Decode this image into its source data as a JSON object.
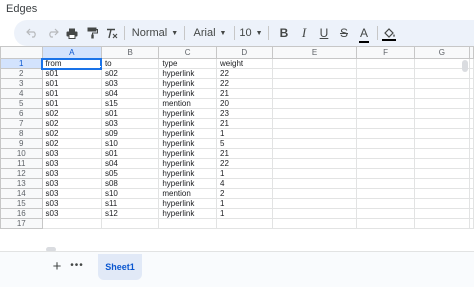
{
  "doc": {
    "title": "Edges"
  },
  "toolbar": {
    "style_label": "Normal",
    "font_label": "Arial",
    "size_label": "10",
    "bold": "B",
    "italic": "I",
    "underline": "U",
    "strikethrough": "S",
    "text_color": "A"
  },
  "grid": {
    "columns": [
      "A",
      "B",
      "C",
      "D",
      "E",
      "F",
      "G"
    ],
    "selected_column": "A",
    "selected_row": 1,
    "rows": [
      {
        "n": "1",
        "cells": [
          "from",
          "to",
          "type",
          "weight"
        ]
      },
      {
        "n": "2",
        "cells": [
          "s01",
          "s02",
          "hyperlink",
          "22"
        ]
      },
      {
        "n": "3",
        "cells": [
          "s01",
          "s03",
          "hyperlink",
          "22"
        ]
      },
      {
        "n": "4",
        "cells": [
          "s01",
          "s04",
          "hyperlink",
          "21"
        ]
      },
      {
        "n": "5",
        "cells": [
          "s01",
          "s15",
          "mention",
          "20"
        ]
      },
      {
        "n": "6",
        "cells": [
          "s02",
          "s01",
          "hyperlink",
          "23"
        ]
      },
      {
        "n": "7",
        "cells": [
          "s02",
          "s03",
          "hyperlink",
          "21"
        ]
      },
      {
        "n": "8",
        "cells": [
          "s02",
          "s09",
          "hyperlink",
          "1"
        ]
      },
      {
        "n": "9",
        "cells": [
          "s02",
          "s10",
          "hyperlink",
          "5"
        ]
      },
      {
        "n": "10",
        "cells": [
          "s03",
          "s01",
          "hyperlink",
          "21"
        ]
      },
      {
        "n": "11",
        "cells": [
          "s03",
          "s04",
          "hyperlink",
          "22"
        ]
      },
      {
        "n": "12",
        "cells": [
          "s03",
          "s05",
          "hyperlink",
          "1"
        ]
      },
      {
        "n": "13",
        "cells": [
          "s03",
          "s08",
          "hyperlink",
          "4"
        ]
      },
      {
        "n": "14",
        "cells": [
          "s03",
          "s10",
          "mention",
          "2"
        ]
      },
      {
        "n": "15",
        "cells": [
          "s03",
          "s11",
          "hyperlink",
          "1"
        ]
      },
      {
        "n": "16",
        "cells": [
          "s03",
          "s12",
          "hyperlink",
          "1"
        ]
      },
      {
        "n": "17",
        "cells": [
          "",
          "",
          "",
          ""
        ]
      }
    ]
  },
  "sheets": {
    "active": "Sheet1"
  },
  "colors": {
    "accent": "#1a73e8",
    "toolbar_bg": "#edf2fa",
    "header_bg": "#f8f9fa",
    "selected_header_bg": "#d3e3fd"
  },
  "icons": [
    "undo-icon",
    "redo-icon",
    "print-icon",
    "paint-format-icon",
    "clear-format-icon",
    "fill-color-icon",
    "add-sheet-icon",
    "all-sheets-icon"
  ]
}
